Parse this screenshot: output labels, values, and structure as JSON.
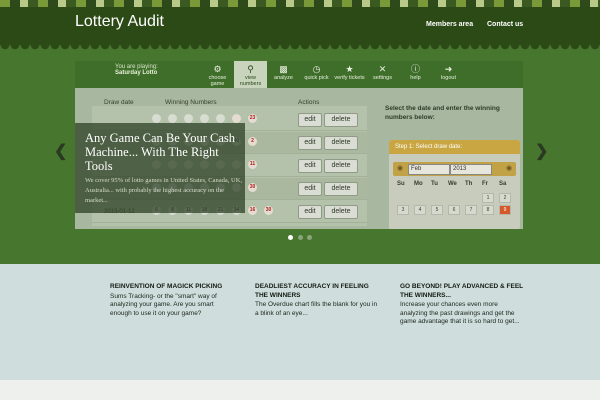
{
  "site": {
    "logo": "Lottery Audit",
    "nav": [
      "Members area",
      "Contact us"
    ]
  },
  "colors": {
    "header_bg": "#2c4a16",
    "hero_bg": "#47772f",
    "features_bg": "#cfdedc",
    "accent_red": "#b01e1e",
    "calendar_gold": "#c9a641"
  },
  "app": {
    "playing_label": "You are playing:",
    "game_name": "Saturday Lotto",
    "tabs": [
      {
        "label": "choose game",
        "icon": "gears-icon"
      },
      {
        "label": "view numbers",
        "icon": "magnifier-icon"
      },
      {
        "label": "analyze",
        "icon": "bar-chart-icon"
      },
      {
        "label": "quick pick",
        "icon": "clock-icon"
      },
      {
        "label": "verify tickets",
        "icon": "star-icon"
      },
      {
        "label": "settings",
        "icon": "tools-icon"
      },
      {
        "label": "help",
        "icon": "info-icon"
      },
      {
        "label": "logout",
        "icon": "logout-icon"
      }
    ],
    "table": {
      "headers": [
        "Draw date",
        "Winning Numbers",
        "Actions"
      ],
      "rows": [
        {
          "date": "",
          "numbers": [
            "",
            "",
            "",
            "",
            "",
            "",
            "23"
          ],
          "highlight": [
            false,
            false,
            false,
            false,
            false,
            true,
            true
          ]
        },
        {
          "date": "",
          "numbers": [
            "",
            "",
            "",
            "",
            "",
            "40",
            "2"
          ],
          "highlight": [
            false,
            false,
            false,
            false,
            false,
            false,
            true
          ]
        },
        {
          "date": "",
          "numbers": [
            "",
            "",
            "",
            "",
            "",
            "",
            "11"
          ],
          "highlight": [
            false,
            false,
            false,
            false,
            false,
            false,
            true
          ]
        },
        {
          "date": "",
          "numbers": [
            "",
            "",
            "",
            "",
            "",
            "",
            "30"
          ],
          "highlight": [
            false,
            false,
            false,
            false,
            false,
            false,
            true
          ]
        },
        {
          "date": "2013-01-12",
          "numbers": [
            "6",
            "8",
            "11",
            "18",
            "21",
            "34",
            "16",
            "30"
          ],
          "highlight": [
            false,
            false,
            false,
            false,
            false,
            false,
            true,
            true
          ]
        }
      ],
      "edit_label": "edit",
      "delete_label": "delete"
    },
    "side_heading": "Select the date and enter the winning numbers below:",
    "step_label": "Step 1: Select draw date:",
    "month": "Feb",
    "year": "2013",
    "weekdays": [
      "Su",
      "Mo",
      "Tu",
      "We",
      "Th",
      "Fr",
      "Sa"
    ],
    "cal_row1": [
      "1",
      "2"
    ],
    "cal_row2": [
      "3",
      "4",
      "5",
      "6",
      "7",
      "8",
      "9"
    ]
  },
  "slide": {
    "title": "Any Game Can Be Your Cash Machine... With The Right Tools",
    "text": "We cover 95% of lotto games in United States, Canada, UK, Australia... with probably the highest accuracy on the market..."
  },
  "features": [
    {
      "title": "REINVENTION OF MAGICK PICKING",
      "text": "Sums Tracking- or the \"smart\" way of analyzing your game. Are you smart enough to use it on your game?"
    },
    {
      "title": "DEADLIEST ACCURACY IN FEELING THE WINNERS",
      "text": "The Overdue chart fills the blank for you in a blink of an eye..."
    },
    {
      "title": "GO BEYOND! PLAY ADVANCED & FEEL THE WINNERS...",
      "text": "Increase your chances even more analyzing the past drawings and get the game advantage that it is so hard to get..."
    }
  ]
}
